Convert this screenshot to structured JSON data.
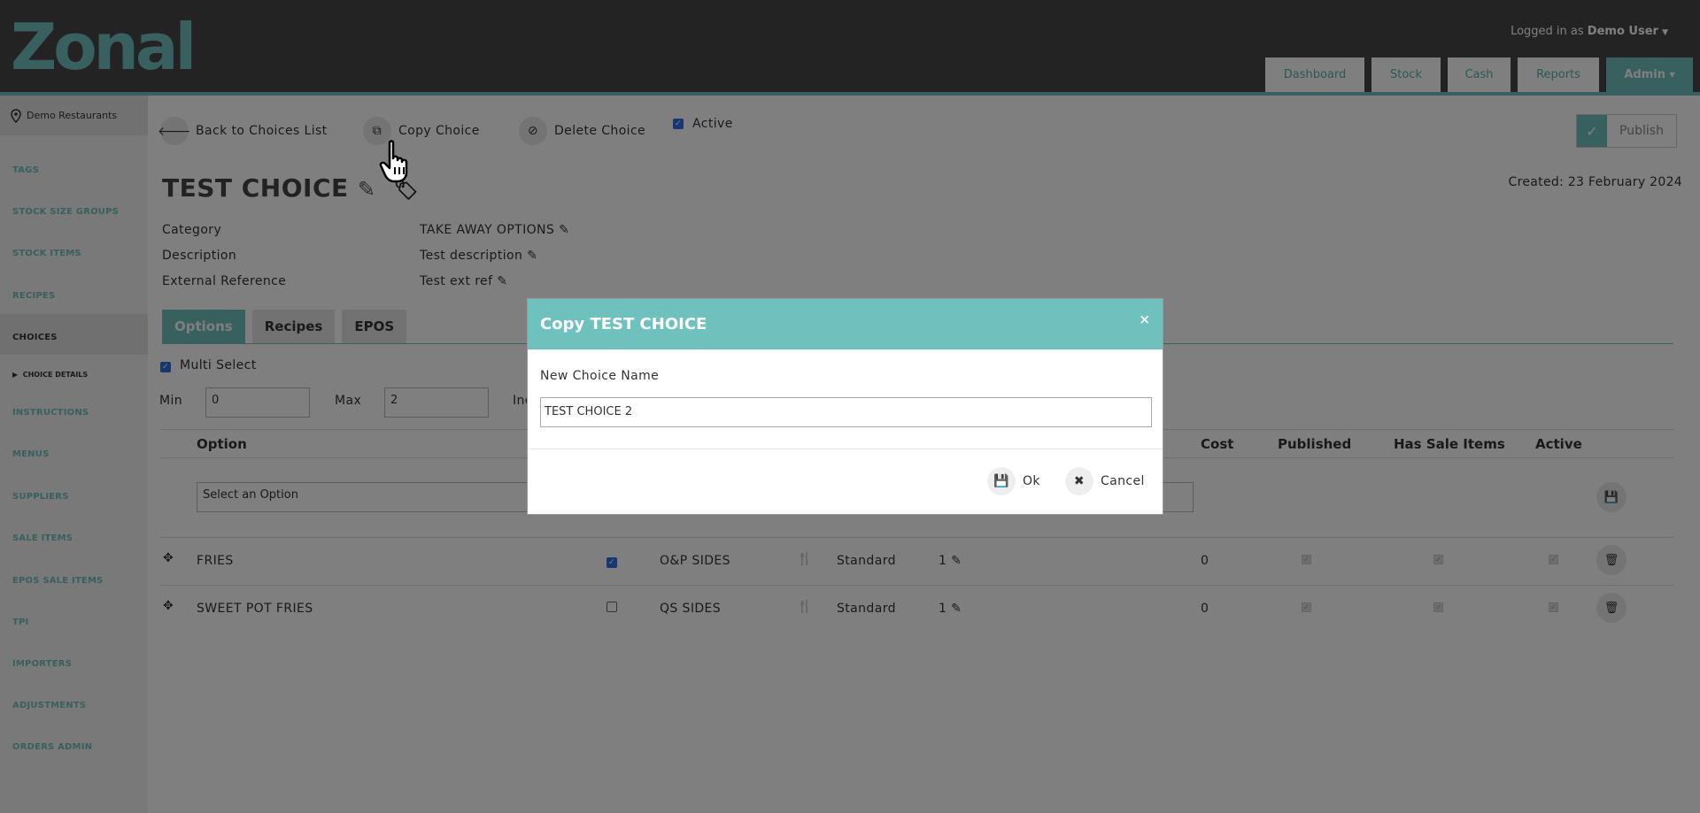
{
  "header": {
    "logo_text": "Zonal",
    "login_prefix": "Logged in as",
    "login_user": "Demo User",
    "nav": [
      "Dashboard",
      "Stock",
      "Cash",
      "Reports",
      "Admin"
    ]
  },
  "sidebar": {
    "venue": "Demo Restaurants",
    "items": [
      "TAGS",
      "STOCK SIZE GROUPS",
      "STOCK ITEMS",
      "RECIPES",
      "CHOICES",
      "INSTRUCTIONS",
      "MENUS",
      "SUPPLIERS",
      "SALE ITEMS",
      "EPOS SALE ITEMS",
      "TPI",
      "IMPORTERS",
      "ADJUSTMENTS",
      "ORDERS ADMIN"
    ],
    "sub_item": "CHOICE DETAILS"
  },
  "toolbar": {
    "back": "Back to Choices List",
    "copy": "Copy Choice",
    "delete": "Delete Choice",
    "active": "Active",
    "publish": "Publish"
  },
  "choice": {
    "title": "TEST CHOICE",
    "created": "Created: 23 February 2024",
    "fields": [
      {
        "label": "Category",
        "value": "TAKE AWAY OPTIONS"
      },
      {
        "label": "Description",
        "value": "Test description"
      },
      {
        "label": "External Reference",
        "value": "Test ext ref"
      }
    ]
  },
  "tabs": [
    "Options",
    "Recipes",
    "EPOS"
  ],
  "options": {
    "multi_select": "Multi Select",
    "min_label": "Min",
    "min_value": "0",
    "max_label": "Max",
    "max_value": "2",
    "inc_label": "Inc",
    "select_placeholder": "Select an Option",
    "columns": [
      "Option",
      "Cost",
      "Published",
      "Has Sale Items",
      "Active"
    ],
    "rows": [
      {
        "name": "FRIES",
        "checked": true,
        "group": "O&P SIDES",
        "type": "Standard",
        "qty": "1",
        "cost": "0"
      },
      {
        "name": "SWEET POT FRIES",
        "checked": false,
        "group": "QS SIDES",
        "type": "Standard",
        "qty": "1",
        "cost": "0"
      }
    ]
  },
  "modal": {
    "title": "Copy TEST CHOICE",
    "close": "×",
    "label": "New Choice Name",
    "value": "TEST CHOICE 2",
    "ok": "Ok",
    "cancel": "Cancel"
  },
  "colors": {
    "accent": "#6fc1be",
    "header": "#474747"
  }
}
